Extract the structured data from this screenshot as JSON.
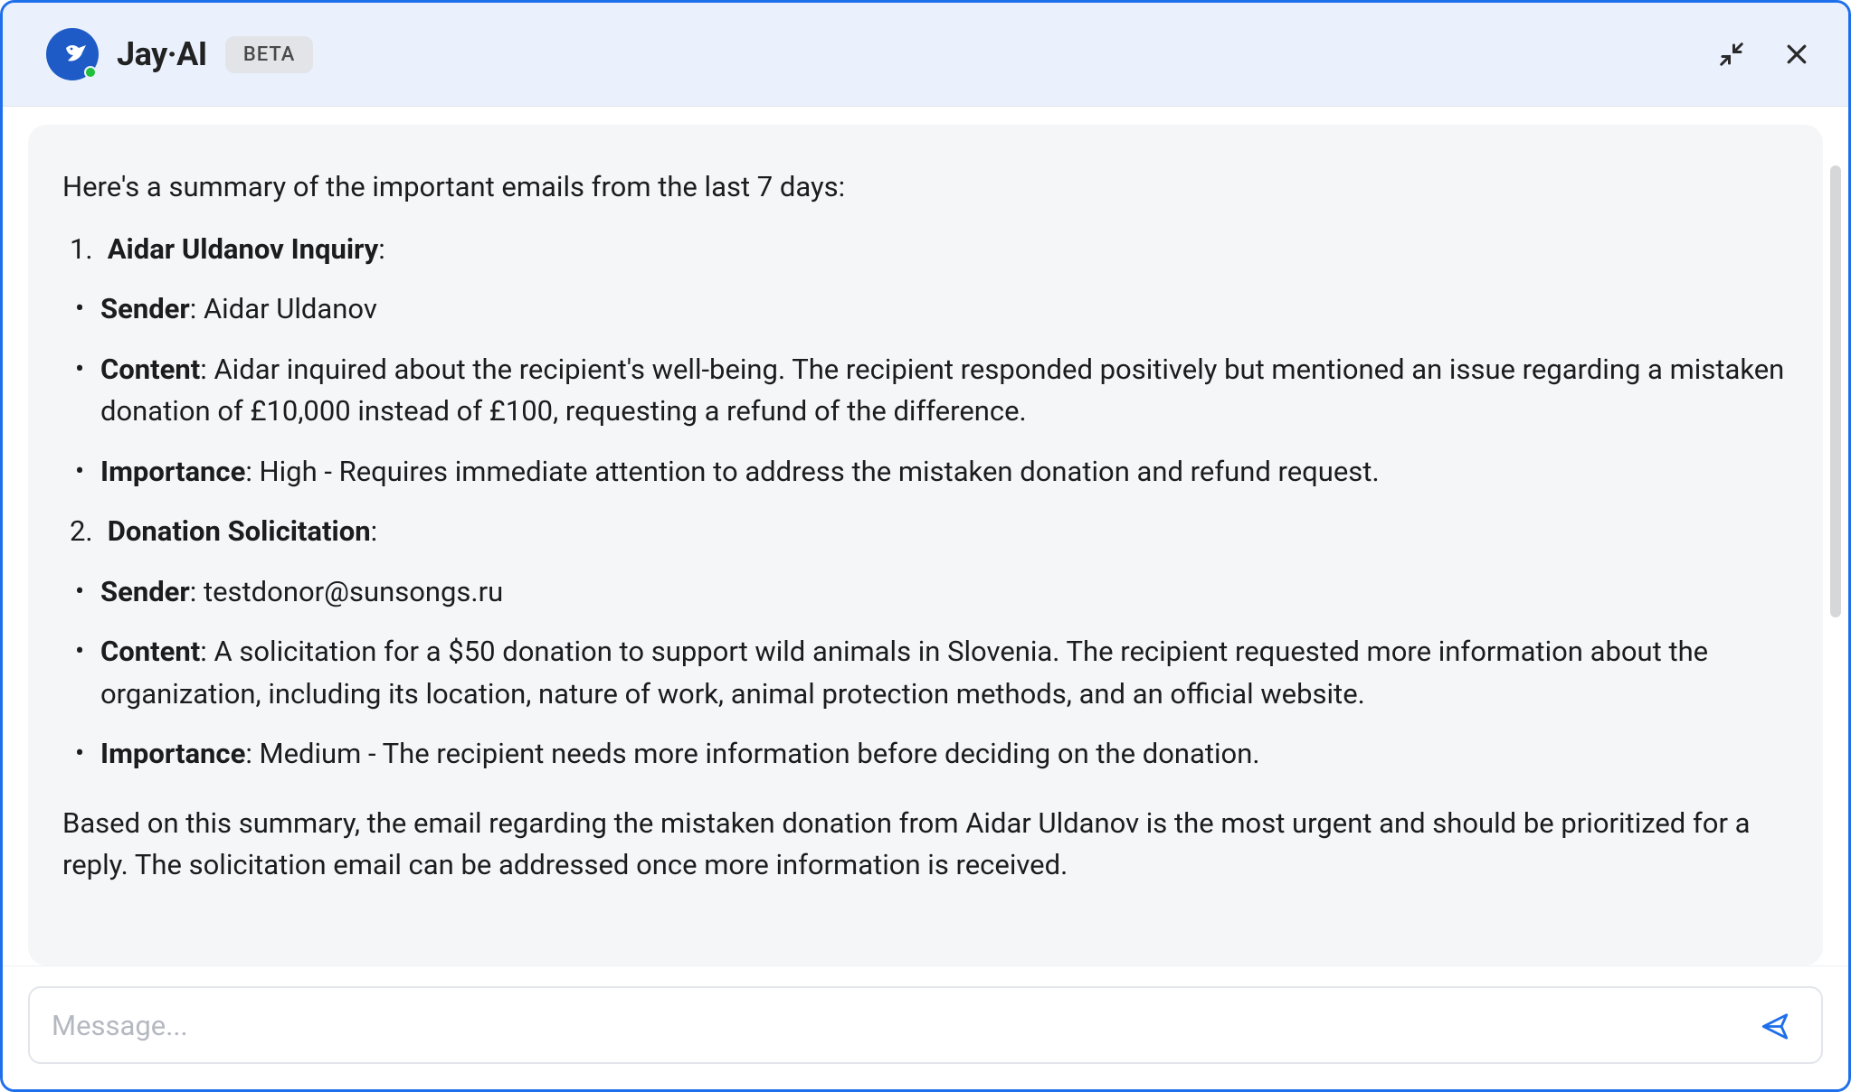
{
  "header": {
    "title": "Jay·AI",
    "badge": "BETA"
  },
  "input": {
    "placeholder": "Message..."
  },
  "content": {
    "intro": "Here's a summary of the important emails from the last 7 days:",
    "item1": {
      "num": "1",
      "title": "Aidar Uldanov Inquiry",
      "sender_label": "Sender",
      "sender_value": ": Aidar Uldanov",
      "content_label": "Content",
      "content_value": ": Aidar inquired about the recipient's well-being. The recipient responded positively but mentioned an issue regarding a mistaken donation of £10,000 instead of £100, requesting a refund of the difference.",
      "importance_label": "Importance",
      "importance_value": ": High - Requires immediate attention to address the mistaken donation and refund request."
    },
    "item2": {
      "num": "2",
      "title": "Donation Solicitation",
      "sender_label": "Sender",
      "sender_value": ": testdonor@sunsongs.ru",
      "content_label": "Content",
      "content_value": ": A solicitation for a $50 donation to support wild animals in Slovenia. The recipient requested more information about the organization, including its location, nature of work, animal protection methods, and an official website.",
      "importance_label": "Importance",
      "importance_value": ": Medium - The recipient needs more information before deciding on the donation."
    },
    "outro": "Based on this summary, the email regarding the mistaken donation from Aidar Uldanov is the most urgent and should be prioritized for a reply. The solicitation email can be addressed once more information is received."
  }
}
